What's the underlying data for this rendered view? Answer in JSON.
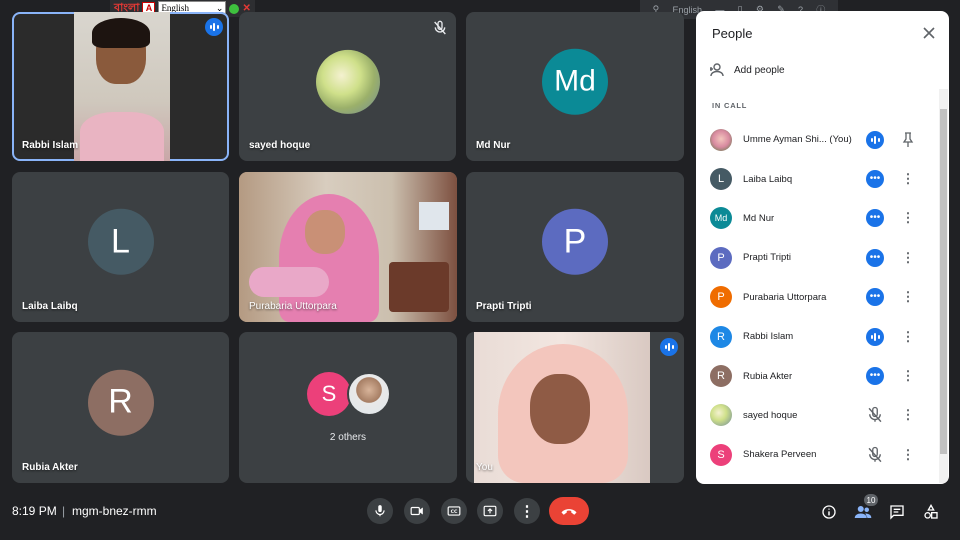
{
  "topbar": {
    "lang_bengali": "বাংলা",
    "lang_select": "English",
    "tray_label": "English"
  },
  "tiles": [
    {
      "name": "Rabbi Islam"
    },
    {
      "name": "sayed hoque"
    },
    {
      "name": "Md Nur",
      "initials": "Md",
      "color": "#0b8a96"
    },
    {
      "name": "Laiba Laibq",
      "initials": "L",
      "color": "#455a64"
    },
    {
      "name": "Purabaria Uttorpara"
    },
    {
      "name": "Prapti Tripti",
      "initials": "P",
      "color": "#5c6bc0"
    },
    {
      "name": "Rubia Akter",
      "initials": "R",
      "color": "#8d6e63"
    },
    {
      "name": "2 others",
      "initials": "S",
      "color": "#ec407a"
    },
    {
      "name": "You"
    }
  ],
  "bottom": {
    "time": "8:19 PM",
    "separator": "|",
    "meeting_code": "mgm-bnez-rmm",
    "participant_count": "10"
  },
  "panel": {
    "title": "People",
    "add_people": "Add people",
    "section_label": "IN CALL",
    "people": [
      {
        "name": "Umme Ayman Shi...",
        "suffix": "(You)",
        "initials": "",
        "color": "#c2185b",
        "state": "speaking",
        "action": "pin"
      },
      {
        "name": "Laiba Laibq",
        "initials": "L",
        "color": "#455a64",
        "state": "more",
        "action": "menu"
      },
      {
        "name": "Md Nur",
        "initials": "Md",
        "color": "#0b8a96",
        "state": "more",
        "action": "menu"
      },
      {
        "name": "Prapti Tripti",
        "initials": "P",
        "color": "#5c6bc0",
        "state": "more",
        "action": "menu"
      },
      {
        "name": "Purabaria Uttorpara",
        "initials": "P",
        "color": "#ef6c00",
        "state": "more",
        "action": "menu"
      },
      {
        "name": "Rabbi Islam",
        "initials": "R",
        "color": "#1e88e5",
        "state": "speaking",
        "action": "menu"
      },
      {
        "name": "Rubia Akter",
        "initials": "R",
        "color": "#8d6e63",
        "state": "more",
        "action": "menu"
      },
      {
        "name": "sayed hoque",
        "initials": "",
        "color": "#9e9d24",
        "state": "muted",
        "action": "menu"
      },
      {
        "name": "Shakera Perveen",
        "initials": "S",
        "color": "#ec407a",
        "state": "muted",
        "action": "menu"
      }
    ]
  }
}
